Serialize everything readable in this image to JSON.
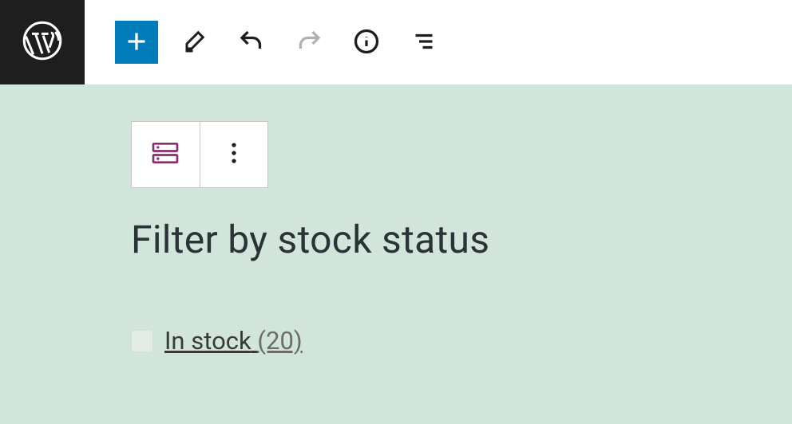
{
  "toolbar": {
    "add_label": "Add block",
    "tools_label": "Tools",
    "undo_label": "Undo",
    "redo_label": "Redo",
    "info_label": "Details",
    "outline_label": "Document outline"
  },
  "block": {
    "type_label": "Filter by Stock block",
    "options_label": "Options",
    "title": "Filter by stock status"
  },
  "filter": {
    "items": [
      {
        "label": "In stock",
        "count": "(20)"
      }
    ]
  }
}
